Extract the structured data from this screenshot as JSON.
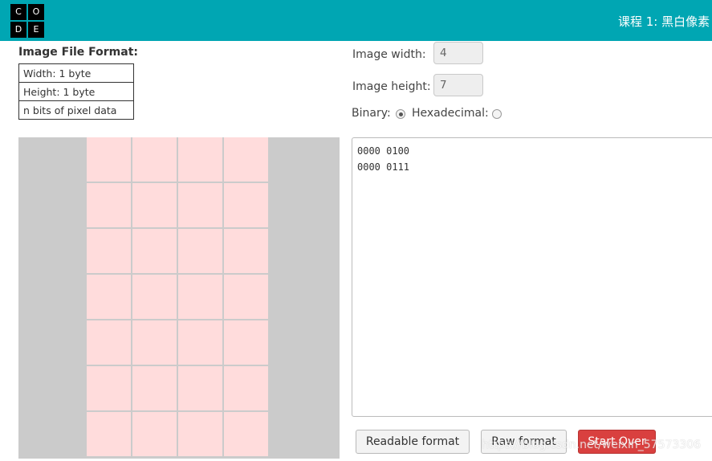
{
  "header": {
    "logo_letters": [
      "C",
      "O",
      "D",
      "E"
    ],
    "course_title": "课程 1: 黑白像素"
  },
  "image_file_format": {
    "title": "Image File Format:",
    "rows": [
      "Width: 1 byte",
      "Height: 1 byte",
      "n bits of pixel data"
    ]
  },
  "pixel_grid": {
    "columns": 4,
    "rows": 7,
    "cell_color": "#ffdcdc",
    "background_color": "#cbcbcb"
  },
  "settings": {
    "width_label": "Image width:",
    "width_value": "4",
    "height_label": "Image height:",
    "height_value": "7",
    "binary_label": "Binary:",
    "binary_selected": true,
    "hex_label": "Hexadecimal:",
    "hex_selected": false
  },
  "editor": {
    "lines": [
      "0000 0100",
      "0000 0111"
    ]
  },
  "buttons": {
    "readable": "Readable format",
    "raw": "Raw format",
    "start_over": "Start Over"
  },
  "watermark": "https://blog.csdn.net/weixin_57573306",
  "colors": {
    "header_bg": "#00a6b3",
    "start_over_bg": "#d9403f"
  }
}
